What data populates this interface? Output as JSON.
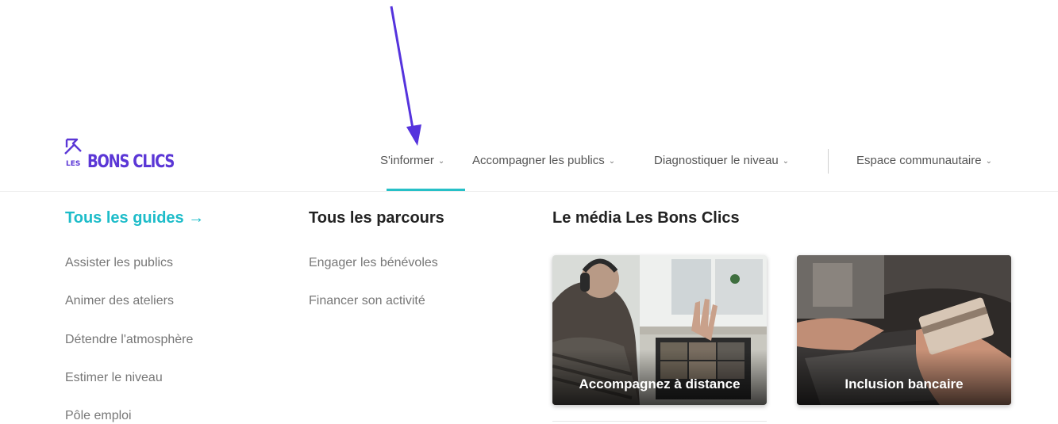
{
  "header": {
    "logo": {
      "small": "LES",
      "main": "BONS CLICS"
    },
    "nav": [
      {
        "label": "S'informer"
      },
      {
        "label": "Accompagner les publics"
      },
      {
        "label": "Diagnostiquer le niveau"
      },
      {
        "label": "Espace communautaire"
      }
    ]
  },
  "menu": {
    "guides": {
      "title": "Tous les guides →",
      "items": [
        "Assister les publics",
        "Animer des ateliers",
        "Détendre l'atmosphère",
        "Estimer le niveau",
        "Pôle emploi"
      ]
    },
    "parcours": {
      "title": "Tous les parcours",
      "items": [
        "Engager les bénévoles",
        "Financer son activité"
      ]
    },
    "media": {
      "title": "Le média Les Bons Clics",
      "cards": [
        {
          "label": "Accompagnez à distance"
        },
        {
          "label": "Inclusion bancaire"
        }
      ]
    }
  },
  "colors": {
    "brand": "#5b37d6",
    "accent": "#1dbcc9",
    "underline": "#26c0c7",
    "annotation": "#5533dd"
  },
  "icons": {
    "chevron": "chevron-down-icon",
    "arrow": "annotation-arrow"
  }
}
